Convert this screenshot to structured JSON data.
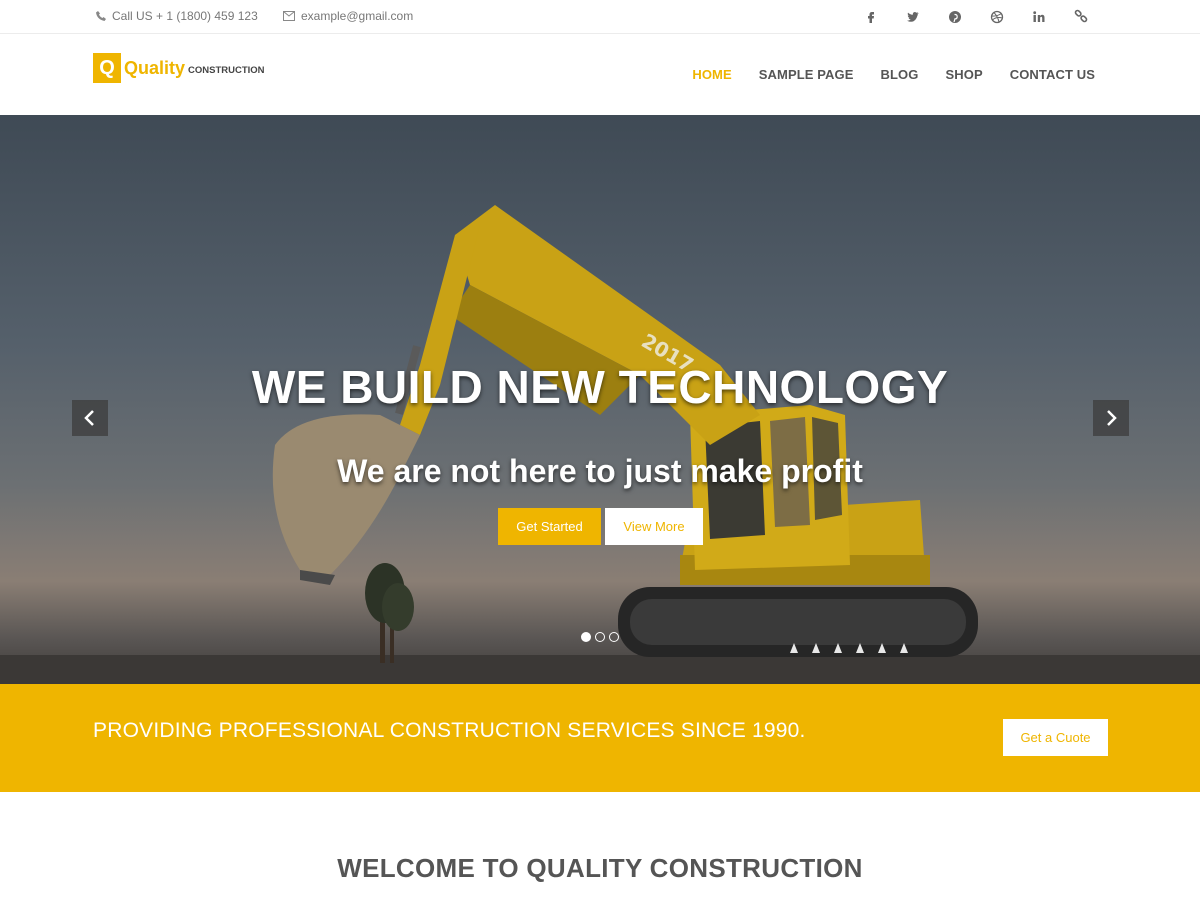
{
  "topbar": {
    "phone": "Call US + 1 (1800) 459 123",
    "email": "example@gmail.com",
    "social": [
      "facebook-icon",
      "twitter-icon",
      "pinterest-icon",
      "dribbble-icon",
      "linkedin-icon",
      "link-icon"
    ]
  },
  "logo": {
    "letter": "Q",
    "name": "Quality",
    "sub": "CONSTRUCTION"
  },
  "nav": {
    "items": [
      {
        "label": "HOME"
      },
      {
        "label": "SAMPLE PAGE"
      },
      {
        "label": "BLOG"
      },
      {
        "label": "SHOP"
      },
      {
        "label": "CONTACT US"
      }
    ]
  },
  "hero": {
    "title": "WE BUILD NEW TECHNOLOGY",
    "subtitle": "We are not here to just make profit",
    "primary_button": "Get Started",
    "secondary_button": "View More",
    "slides": 3,
    "active_slide": 1,
    "excavator_label": "2017"
  },
  "banner": {
    "text": "PROVIDING PROFESSIONAL CONSTRUCTION SERVICES SINCE 1990.",
    "button": "Get a Cuote"
  },
  "welcome": {
    "title": "WELCOME TO QUALITY CONSTRUCTION"
  },
  "colors": {
    "accent": "#efb500",
    "text": "#555555"
  }
}
